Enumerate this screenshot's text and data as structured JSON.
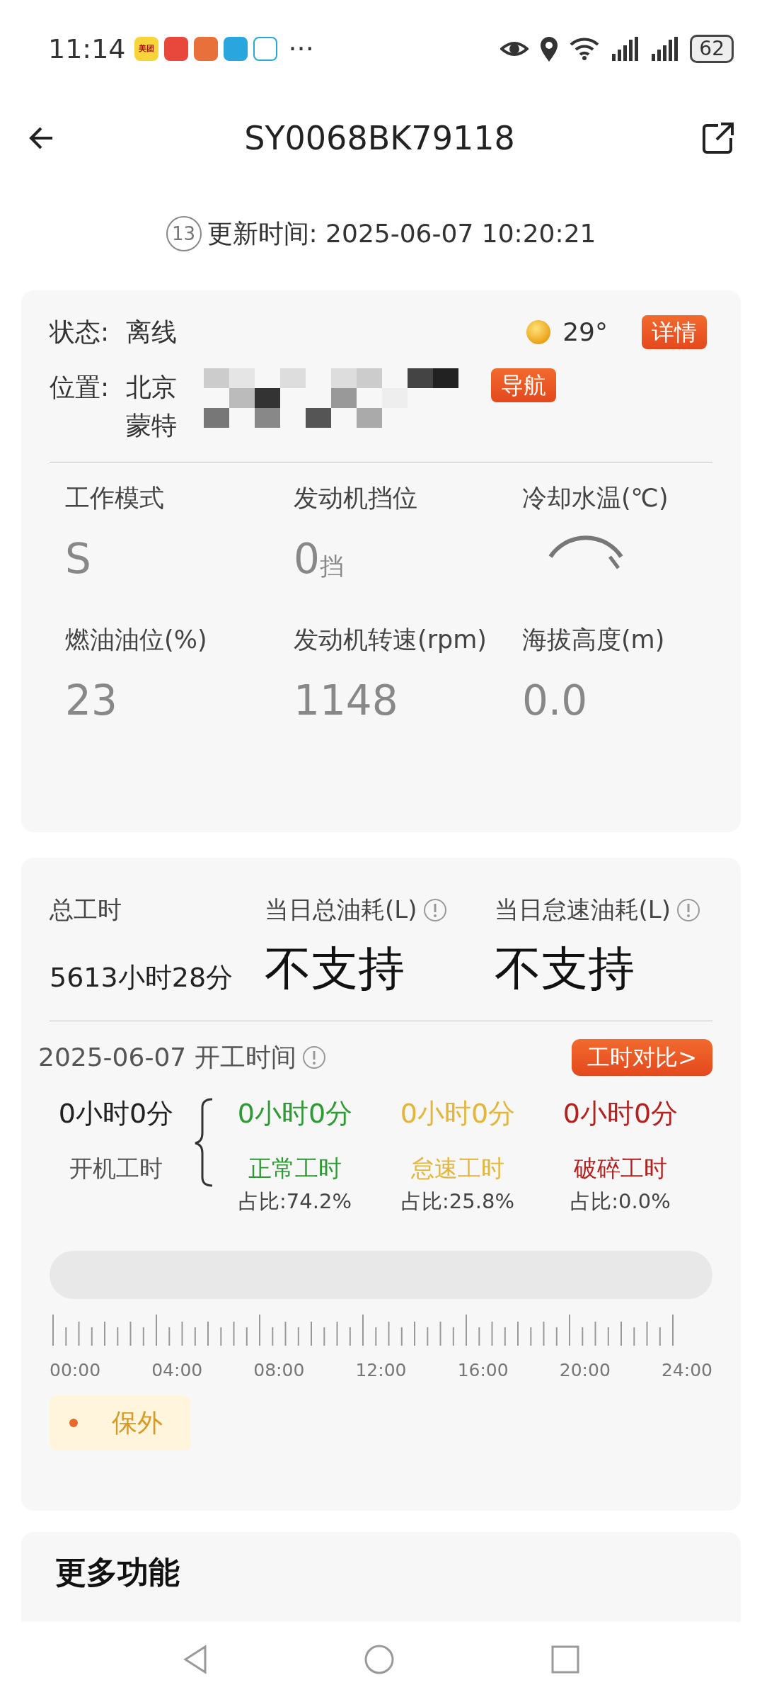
{
  "status_bar": {
    "time": "11:14",
    "app_icons": [
      {
        "label": "美团",
        "color": "#f7d43a"
      },
      {
        "color": "#e8473c"
      },
      {
        "color": "#e8703a"
      },
      {
        "color": "#2aa6de"
      },
      {
        "color": "#ffffff"
      }
    ],
    "more": "···",
    "battery": "62"
  },
  "header": {
    "title": "SY0068BK79118"
  },
  "update": {
    "badge": "13",
    "text": "更新时间: 2025-06-07 10:20:21"
  },
  "status_card": {
    "status_label": "状态:",
    "status_value": "离线",
    "temperature": "29°",
    "detail_button": "详情",
    "location_label": "位置:",
    "location_lines": [
      "北京",
      "蒙特"
    ],
    "nav_button": "导航",
    "metrics": [
      {
        "label": "工作模式",
        "value": "S",
        "kind": "text"
      },
      {
        "label": "发动机挡位",
        "value": "0",
        "unit": "挡",
        "kind": "text"
      },
      {
        "label": "冷却水温(℃)",
        "kind": "gauge"
      },
      {
        "label": "燃油油位(%)",
        "value": "23",
        "kind": "text"
      },
      {
        "label": "发动机转速(rpm)",
        "value": "1148",
        "kind": "text"
      },
      {
        "label": "海拔高度(m)",
        "value": "0.0",
        "kind": "text"
      }
    ]
  },
  "work_card": {
    "totals": [
      {
        "label": "总工时",
        "value": "5613小时28分",
        "info": false,
        "big": false
      },
      {
        "label": "当日总油耗(L)",
        "value": "不支持",
        "info": true,
        "big": true
      },
      {
        "label": "当日怠速油耗(L)",
        "value": "不支持",
        "info": true,
        "big": true
      }
    ],
    "date_title": "2025-06-07 开工时间",
    "compare_button": "工时对比>",
    "on_time": {
      "value": "0小时0分",
      "label": "开机工时"
    },
    "breakdown": [
      {
        "value": "0小时0分",
        "label": "正常工时",
        "share": "占比:74.2%",
        "color": "#2e9a34"
      },
      {
        "value": "0小时0分",
        "label": "怠速工时",
        "share": "占比:25.8%",
        "color": "#e3b53a"
      },
      {
        "value": "0小时0分",
        "label": "破碎工时",
        "share": "占比:0.0%",
        "color": "#b3221f"
      }
    ],
    "timeline_labels": [
      "00:00",
      "04:00",
      "08:00",
      "12:00",
      "16:00",
      "20:00",
      "24:00"
    ],
    "legend": {
      "label": "保外",
      "color": "#e8692e"
    }
  },
  "more_card": {
    "title": "更多功能"
  }
}
